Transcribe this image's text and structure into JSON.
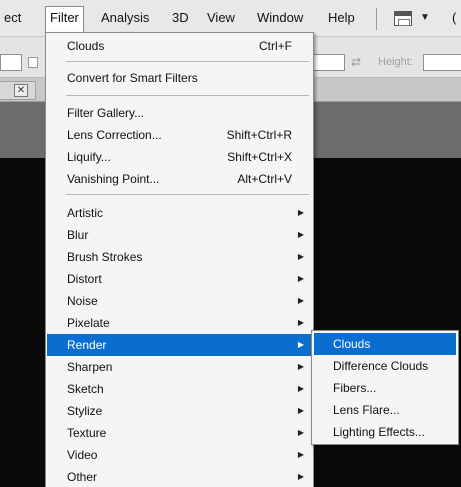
{
  "menubar": {
    "items": [
      "ect",
      "Filter",
      "Analysis",
      "3D",
      "View",
      "Window",
      "Help"
    ],
    "active_item": "Filter",
    "right_cut": "("
  },
  "options_bar": {
    "height_label": "Height:"
  },
  "filter_menu": {
    "last_filter": {
      "label": "Clouds",
      "shortcut": "Ctrl+F"
    },
    "convert_smart": "Convert for Smart Filters",
    "tools": [
      {
        "label": "Filter Gallery...",
        "shortcut": ""
      },
      {
        "label": "Lens Correction...",
        "shortcut": "Shift+Ctrl+R"
      },
      {
        "label": "Liquify...",
        "shortcut": "Shift+Ctrl+X"
      },
      {
        "label": "Vanishing Point...",
        "shortcut": "Alt+Ctrl+V"
      }
    ],
    "categories": [
      "Artistic",
      "Blur",
      "Brush Strokes",
      "Distort",
      "Noise",
      "Pixelate",
      "Render",
      "Sharpen",
      "Sketch",
      "Stylize",
      "Texture",
      "Video",
      "Other"
    ],
    "highlighted": "Render"
  },
  "render_submenu": {
    "items": [
      "Clouds",
      "Difference Clouds",
      "Fibers...",
      "Lens Flare...",
      "Lighting Effects..."
    ],
    "highlighted": "Clouds"
  },
  "colors": {
    "highlight": "#0a6ed1",
    "menu_bg": "#f5f5f5",
    "canvas": "#0a0a0a",
    "menubar_bg": "#e8e8e8"
  },
  "icons": [
    "workspace-switcher-icon",
    "swap-icon",
    "close-icon",
    "submenu-arrow-icon"
  ]
}
